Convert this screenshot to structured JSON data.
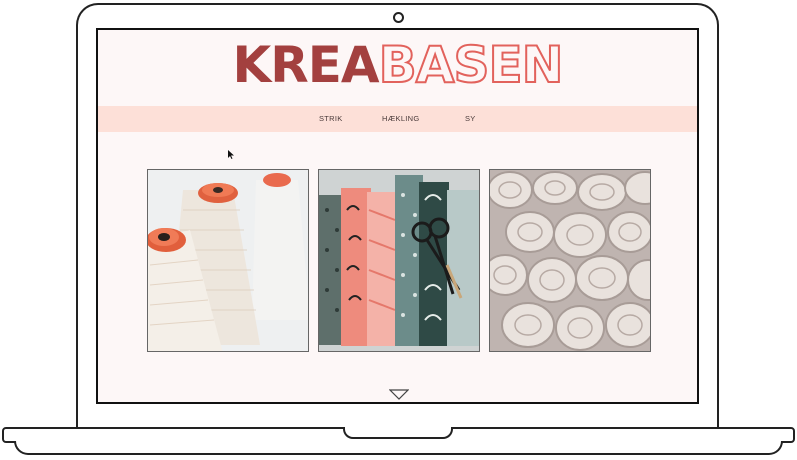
{
  "site": {
    "logo_part1": "KREA",
    "logo_part2": "BASEN"
  },
  "nav": {
    "items": [
      {
        "label": "STRIK"
      },
      {
        "label": "HÆKLING"
      },
      {
        "label": "SY"
      }
    ]
  },
  "tiles": [
    {
      "subject": "yarn cones"
    },
    {
      "subject": "patterned fabrics with scissors"
    },
    {
      "subject": "rolled fabric"
    }
  ],
  "icons": {
    "scroll": "triangle-down-icon",
    "cursor": "mouse-pointer-icon"
  },
  "colors": {
    "logo_solid": "#a3403f",
    "logo_outline": "#e2625c",
    "nav_background": "#fde0d8",
    "page_background": "#fdf7f7"
  }
}
